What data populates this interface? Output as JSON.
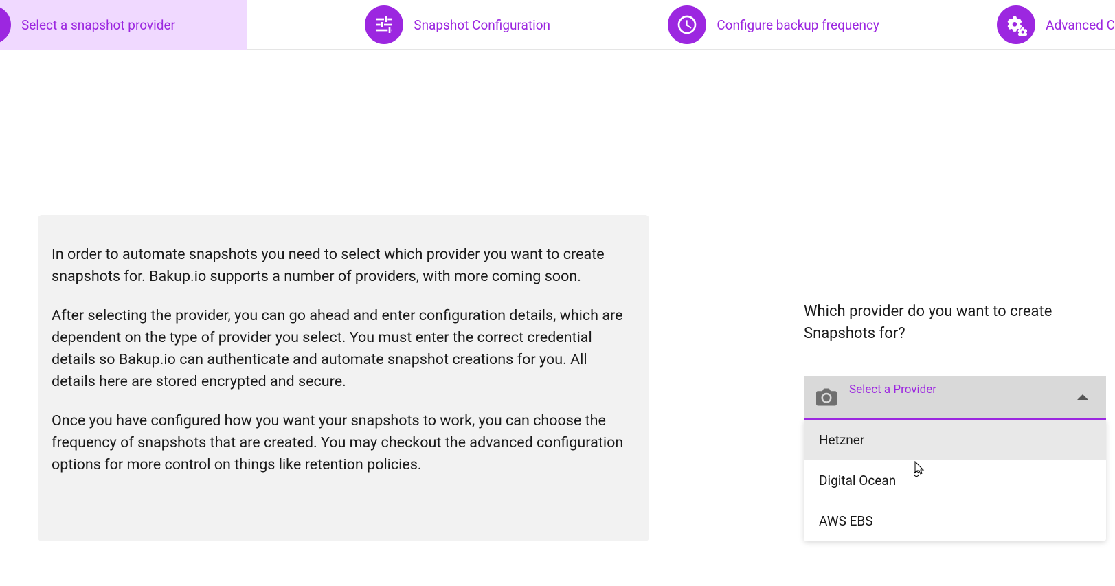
{
  "stepper": {
    "steps": [
      {
        "label": "Select a snapshot provider"
      },
      {
        "label": "Snapshot Configuration"
      },
      {
        "label": "Configure backup frequency"
      },
      {
        "label": "Advanced C"
      }
    ]
  },
  "info": {
    "p1": "In order to automate snapshots you need to select which provider you want to create snapshots for. Bakup.io supports a number of providers, with more coming soon.",
    "p2": "After selecting the provider, you can go ahead and enter configuration details, which are dependent on the type of provider you select. You must enter the correct credential details so Bakup.io can authenticate and automate snapshot creations for you. All details here are stored encrypted and secure.",
    "p3": "Once you have configured how you want your snapshots to work, you can choose the frequency of snapshots that are created. You may checkout the advanced configuration options for more control on things like retention policies."
  },
  "selector": {
    "question": "Which provider do you want to create Snapshots for?",
    "placeholder": "Select a Provider",
    "options": [
      "Hetzner",
      "Digital Ocean",
      "AWS EBS"
    ]
  }
}
